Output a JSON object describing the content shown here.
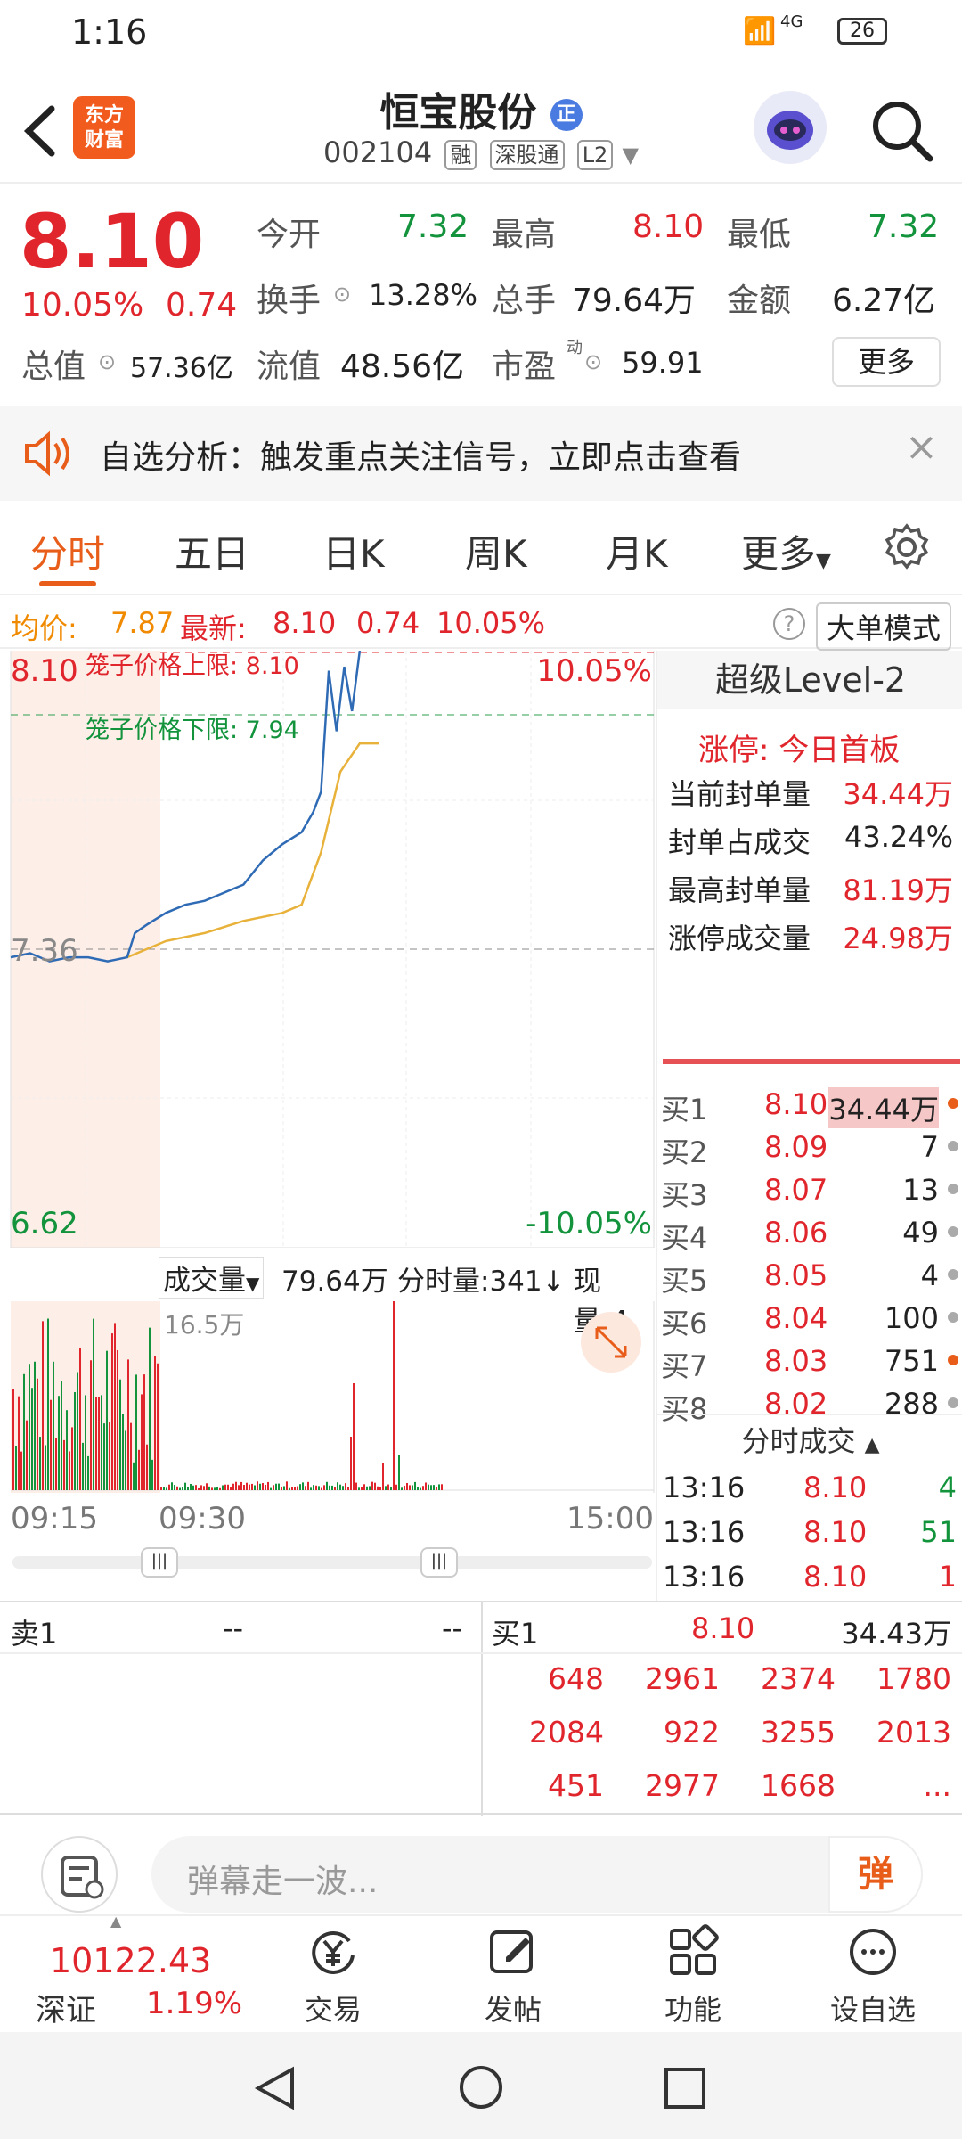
{
  "status": {
    "time": "1:16",
    "net": "4G",
    "battery": "26"
  },
  "header": {
    "logo_line1": "东方",
    "logo_line2": "财富",
    "title": "恒宝股份",
    "title_badge": "正",
    "code": "002104",
    "tags": [
      "融",
      "深股通",
      "L2"
    ]
  },
  "quote": {
    "price": "8.10",
    "change_pct": "10.05%",
    "change": "0.74",
    "open_label": "今开",
    "open": "7.32",
    "high_label": "最高",
    "high": "8.10",
    "low_label": "最低",
    "low": "7.32",
    "turnover_label": "换手",
    "turnover": "13.28%",
    "volume_label": "总手",
    "volume": "79.64万",
    "amount_label": "金额",
    "amount": "6.27亿",
    "mcap_label": "总值",
    "mcap": "57.36亿",
    "float_label": "流值",
    "float": "48.56亿",
    "pe_label": "市盈",
    "pe_sup": "动",
    "pe": "59.91",
    "more": "更多"
  },
  "banner": {
    "text": "自选分析：触发重点关注信号，立即点击查看"
  },
  "tabs": [
    "分时",
    "五日",
    "日K",
    "周K",
    "月K",
    "更多"
  ],
  "infobar": {
    "avg_label": "均价:",
    "avg": "7.87",
    "latest_label": "最新:",
    "latest": "8.10",
    "chg": "0.74",
    "pct": "10.05%",
    "mode_btn": "大单模式"
  },
  "chart": {
    "top_price": "8.10",
    "top_pct": "10.05%",
    "bottom_price": "6.62",
    "bottom_pct": "-10.05%",
    "ref_price": "7.36",
    "upper_limit_label": "笼子价格上限: 8.10",
    "lower_limit_label": "笼子价格下限: 7.94",
    "vol_label": "成交量",
    "vol_total": "79.64万",
    "fenshi_label": "分时量:341↓",
    "xianliang_label": "现量:4",
    "vol_max": "16.5万",
    "time_start": "09:15",
    "time_mid": "09:30",
    "time_end": "15:00"
  },
  "chart_data": {
    "type": "line",
    "series": [
      {
        "name": "最新",
        "points": [
          [
            0,
            7.34
          ],
          [
            0.5,
            7.35
          ],
          [
            1,
            7.33
          ],
          [
            1.5,
            7.34
          ],
          [
            2,
            7.34
          ],
          [
            2.5,
            7.33
          ],
          [
            3,
            7.34
          ],
          [
            3.2,
            7.4
          ],
          [
            3.5,
            7.42
          ],
          [
            4,
            7.45
          ],
          [
            4.5,
            7.47
          ],
          [
            5,
            7.48
          ],
          [
            5.5,
            7.5
          ],
          [
            6,
            7.52
          ],
          [
            6.5,
            7.58
          ],
          [
            7,
            7.62
          ],
          [
            7.5,
            7.65
          ],
          [
            7.8,
            7.7
          ],
          [
            8,
            7.75
          ],
          [
            8.2,
            8.05
          ],
          [
            8.4,
            7.9
          ],
          [
            8.6,
            8.06
          ],
          [
            8.8,
            7.95
          ],
          [
            9,
            8.1
          ]
        ]
      },
      {
        "name": "均价",
        "points": [
          [
            3,
            7.34
          ],
          [
            4,
            7.38
          ],
          [
            5,
            7.4
          ],
          [
            6,
            7.43
          ],
          [
            7,
            7.45
          ],
          [
            7.5,
            7.47
          ],
          [
            8,
            7.6
          ],
          [
            8.5,
            7.8
          ],
          [
            9,
            7.87
          ],
          [
            9.5,
            7.87
          ]
        ]
      }
    ],
    "ylim": [
      6.62,
      8.1
    ]
  },
  "level2": {
    "title": "超级Level-2",
    "limit_up": "涨停: 今日首板",
    "rows": [
      {
        "label": "当前封单量",
        "value": "34.44万"
      },
      {
        "label": "封单占成交",
        "value": "43.24%"
      },
      {
        "label": "最高封单量",
        "value": "81.19万"
      },
      {
        "label": "涨停成交量",
        "value": "24.98万"
      }
    ]
  },
  "bids": [
    {
      "label": "买1",
      "price": "8.10",
      "vol": "34.44万"
    },
    {
      "label": "买2",
      "price": "8.09",
      "vol": "7"
    },
    {
      "label": "买3",
      "price": "8.07",
      "vol": "13"
    },
    {
      "label": "买4",
      "price": "8.06",
      "vol": "49"
    },
    {
      "label": "买5",
      "price": "8.05",
      "vol": "4"
    },
    {
      "label": "买6",
      "price": "8.04",
      "vol": "100"
    },
    {
      "label": "买7",
      "price": "8.03",
      "vol": "751"
    },
    {
      "label": "买8",
      "price": "8.02",
      "vol": "288"
    }
  ],
  "trades": {
    "title": "分时成交",
    "rows": [
      {
        "t": "13:16",
        "p": "8.10",
        "v": "4"
      },
      {
        "t": "13:16",
        "p": "8.10",
        "v": "51"
      },
      {
        "t": "13:16",
        "p": "8.10",
        "v": "1"
      }
    ]
  },
  "queue": {
    "sell_label": "卖1",
    "sell_a": "--",
    "sell_b": "--",
    "buy_label": "买1",
    "buy_price": "8.10",
    "buy_vol": "34.43万",
    "rows": [
      [
        "648",
        "2961",
        "2374",
        "1780"
      ],
      [
        "2084",
        "922",
        "3255",
        "2013"
      ],
      [
        "451",
        "2977",
        "1668",
        "..."
      ]
    ]
  },
  "danmu": {
    "placeholder": "弹幕走一波...",
    "btn": "弹"
  },
  "bottom": {
    "index": "10122.43",
    "index_name": "深证",
    "index_pct": "1.19%",
    "items": [
      "交易",
      "发帖",
      "功能",
      "设自选"
    ]
  }
}
